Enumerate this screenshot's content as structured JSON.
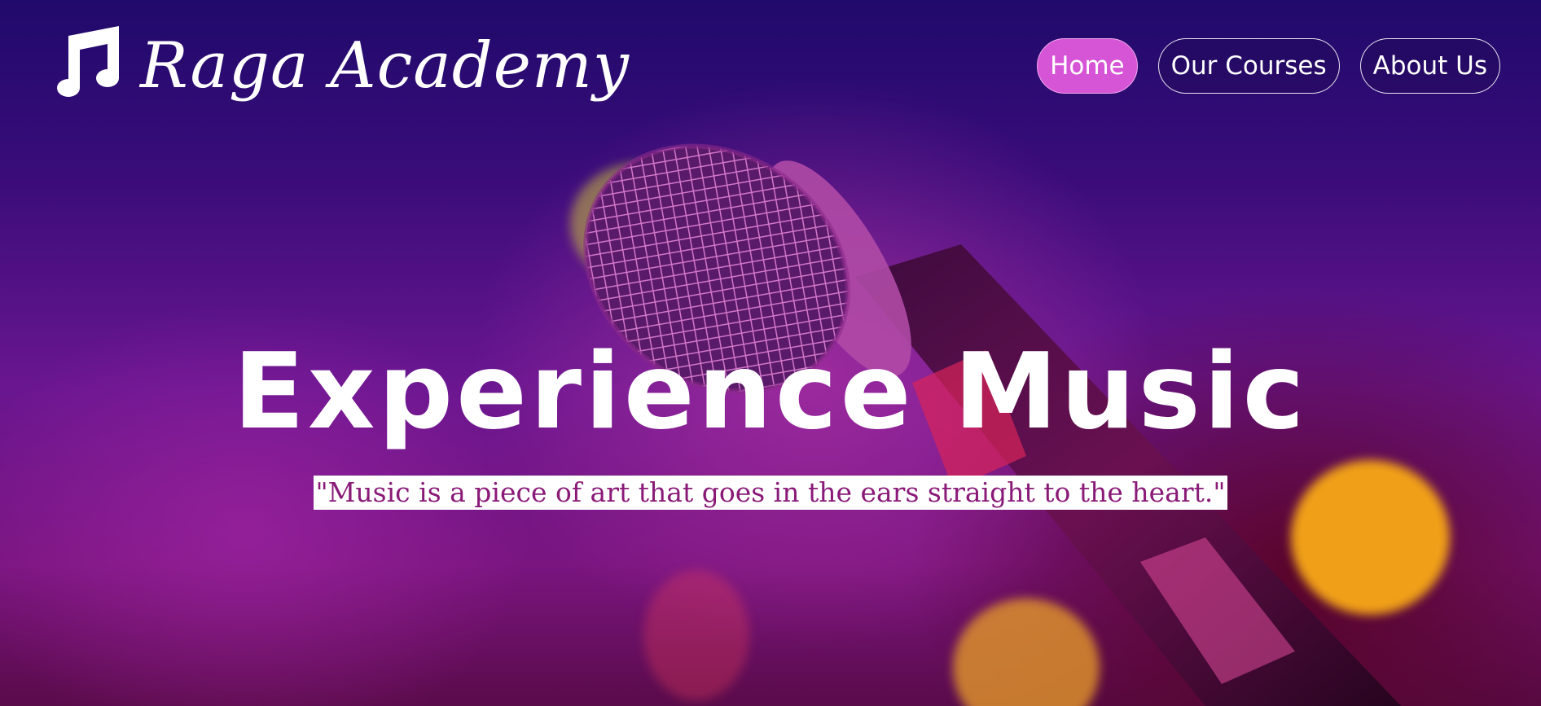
{
  "brand": {
    "name": "Raga Academy",
    "icon": "music-note-icon"
  },
  "nav": {
    "items": [
      {
        "label": "Home",
        "active": true
      },
      {
        "label": "Our Courses",
        "active": false
      },
      {
        "label": "About Us",
        "active": false
      }
    ]
  },
  "hero": {
    "headline": "Experience Music",
    "quote": "\"Music is a piece of art that goes in the ears straight to the heart.\"",
    "background_image": "microphone-stage-lights"
  },
  "colors": {
    "active_nav": "#d654d6",
    "quote_text": "#8a1a78",
    "background": "#3a0c7a"
  }
}
